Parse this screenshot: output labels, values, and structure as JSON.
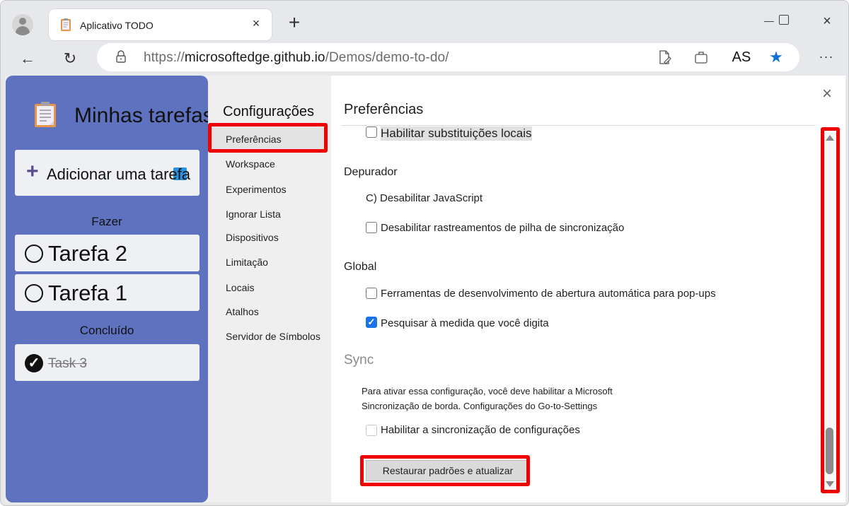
{
  "browser": {
    "tab": {
      "title": "Aplicativo TODO",
      "favicon": "clipboard-icon",
      "close_icon": "×"
    },
    "new_tab_icon": "+",
    "window_controls": {
      "minimize": "minimize-icon",
      "maximize": "maximize-icon",
      "close": "×"
    },
    "nav": {
      "back_icon": "←",
      "refresh_icon": "↻"
    },
    "address": {
      "scheme": "https://",
      "host": "microsoftedge.github.io",
      "path": "/Demos/demo-to-do/"
    },
    "toolbar": {
      "read_aloud": "read-document-icon",
      "apps": "app-icon",
      "profile_initials": "AS",
      "favorite_icon": "★",
      "more_icon": "···"
    }
  },
  "todo": {
    "title": "Minhas tarefas",
    "add_task_label": "Adicionar uma tarefa",
    "add_icon": "+",
    "sections": {
      "todo": "Fazer",
      "done": "Concluído"
    },
    "tasks_todo": [
      {
        "label": "Tarefa 2",
        "done": false
      },
      {
        "label": "Tarefa 1",
        "done": false
      }
    ],
    "tasks_done": [
      {
        "label": "Task 3",
        "done": true,
        "check_icon": "✓"
      }
    ]
  },
  "devtools_settings": {
    "nav_title": "Configurações",
    "nav_items": [
      {
        "label": "Preferências",
        "active": true
      },
      {
        "label": "Workspace",
        "active": false
      },
      {
        "label": "Experimentos",
        "active": false
      },
      {
        "label": "Ignorar Lista",
        "active": false
      },
      {
        "label": "Dispositivos",
        "active": false
      },
      {
        "label": "Limitação",
        "active": false
      },
      {
        "label": "Locais",
        "active": false
      },
      {
        "label": "Atalhos",
        "active": false
      },
      {
        "label": "Servidor de Símbolos",
        "active": false
      }
    ],
    "panel_title": "Preferências",
    "close_icon": "×",
    "options": {
      "local_overrides": {
        "label": "Habilitar substituições locais",
        "checked": false
      },
      "debugger_title": "Depurador",
      "disable_js": {
        "label": "C) Desabilitar JavaScript"
      },
      "disable_async": {
        "label": "Desabilitar rastreamentos de pilha de sincronização",
        "checked": false
      },
      "global_title": "Global",
      "auto_open": {
        "label": "Ferramentas de desenvolvimento de abertura automática para pop-ups",
        "checked": false
      },
      "search_as_type": {
        "label": "Pesquisar à medida que você digita",
        "checked": true,
        "check_icon": "✓"
      },
      "sync_title": "Sync",
      "sync_desc_line1": "Para ativar essa configuração, você deve habilitar a Microsoft",
      "sync_desc_line2": "Sincronização de borda. Configurações do Go-to-Settings",
      "enable_sync": {
        "label": "Habilitar a sincronização de configurações",
        "checked": false,
        "disabled": true
      }
    },
    "restore_button": "Restaurar padrões e atualizar",
    "scroll_position": 0.95
  },
  "highlight_color": "#f00000",
  "accent_color": "#1a73d6",
  "todo_bg_color": "#5f72c0"
}
